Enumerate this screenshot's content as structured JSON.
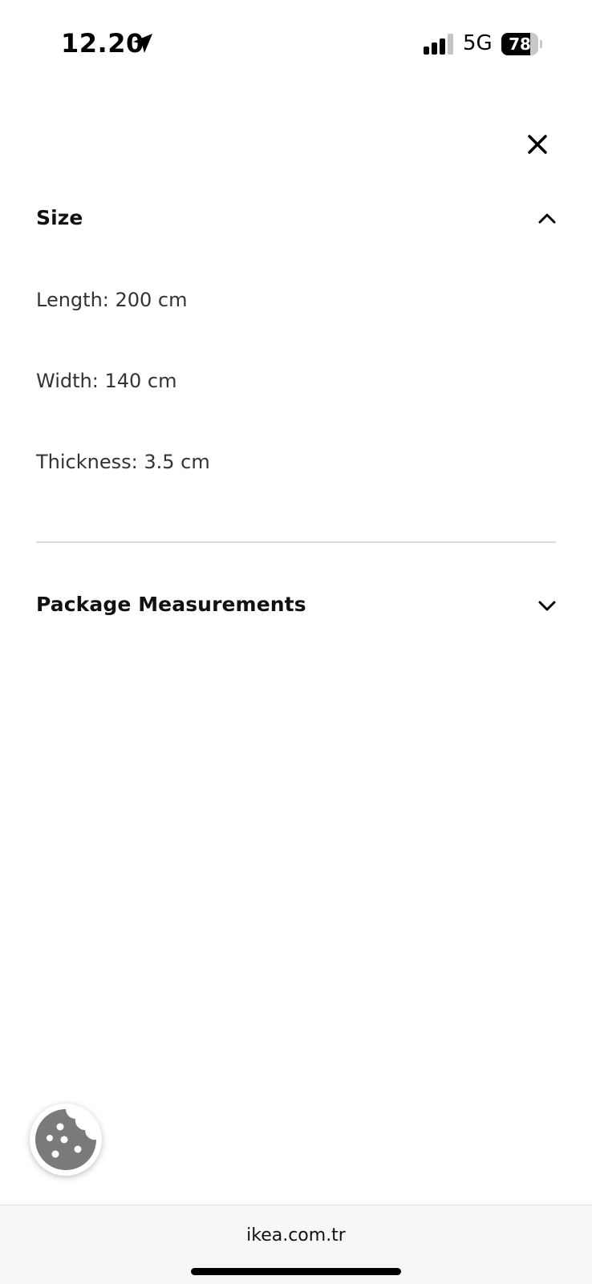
{
  "status_bar": {
    "time": "12.20",
    "network": "5G",
    "battery_percent": "78",
    "battery_level": 0.78,
    "signal_bars_active": 3,
    "signal_bars_total": 4,
    "icons": [
      "location-arrow-icon",
      "signal-icon",
      "battery-icon"
    ]
  },
  "close_icon": "close-icon",
  "sections": {
    "size": {
      "title": "Size",
      "expanded": true,
      "chevron": "chevron-up-icon",
      "items": [
        "Length: 200 cm",
        "Width: 140 cm",
        "Thickness: 3.5 cm"
      ]
    },
    "package": {
      "title": "Package Measurements",
      "expanded": false,
      "chevron": "chevron-down-icon"
    }
  },
  "cookie_button": {
    "icon": "cookie-icon",
    "color": "#7a7a7a"
  },
  "browser": {
    "url": "ikea.com.tr"
  }
}
